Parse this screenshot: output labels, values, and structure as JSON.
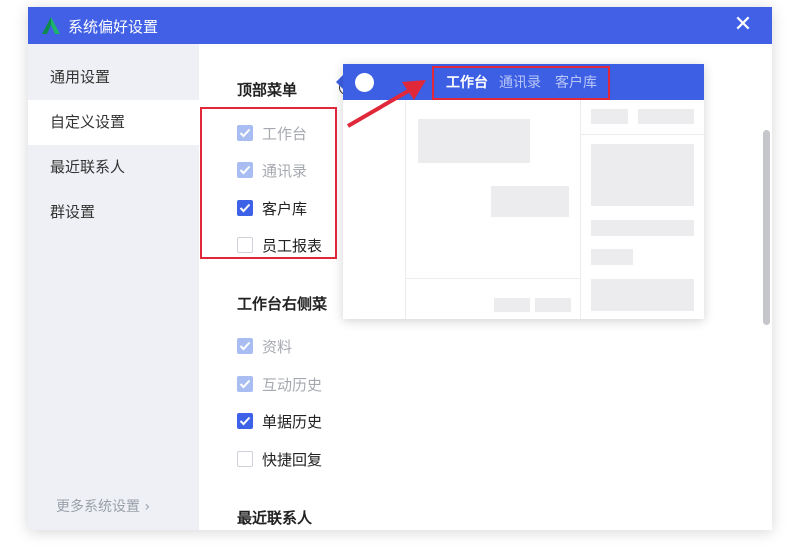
{
  "window": {
    "title": "系统偏好设置",
    "close_glyph": "✕",
    "colors": {
      "titlebar": "#4160e6",
      "accent": "#3d62e8",
      "highlight_red": "#e0283a"
    }
  },
  "sidebar": {
    "items": [
      {
        "label": "通用设置"
      },
      {
        "label": "自定义设置"
      },
      {
        "label": "最近联系人"
      },
      {
        "label": "群设置"
      }
    ],
    "active": "自定义设置",
    "more_link": "更多系统设置 ›"
  },
  "sections": {
    "top_menu": {
      "title": "顶部菜单",
      "info_icon": "i",
      "options": [
        {
          "label": "工作台",
          "state": "checked-disabled"
        },
        {
          "label": "通讯录",
          "state": "checked-disabled"
        },
        {
          "label": "客户库",
          "state": "checked"
        },
        {
          "label": "员工报表",
          "state": "unchecked"
        }
      ]
    },
    "workbench_right_menu": {
      "title": "工作台右侧菜",
      "options": [
        {
          "label": "资料",
          "state": "checked-disabled"
        },
        {
          "label": "互动历史",
          "state": "checked-disabled"
        },
        {
          "label": "单据历史",
          "state": "checked"
        },
        {
          "label": "快捷回复",
          "state": "unchecked"
        }
      ]
    },
    "recent_contacts": {
      "title": "最近联系人"
    }
  },
  "preview": {
    "tabs": [
      "工作台",
      "通讯录",
      "客户库"
    ],
    "active_tab": "工作台"
  }
}
